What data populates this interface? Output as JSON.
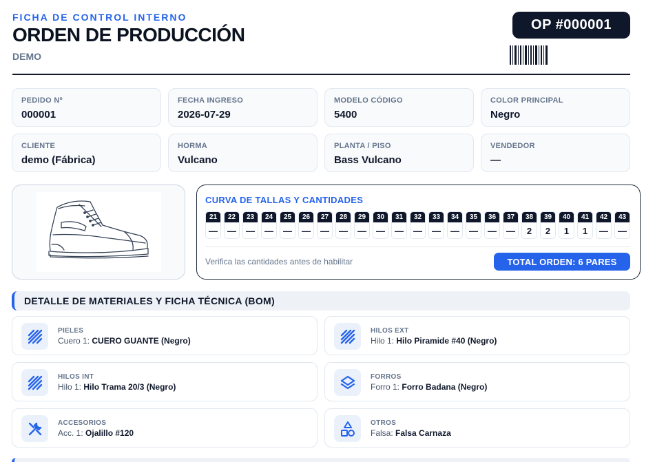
{
  "header": {
    "eyebrow": "FICHA DE CONTROL INTERNO",
    "title": "ORDEN DE PRODUCCIÓN",
    "subtitle": "DEMO",
    "op_badge": "OP #000001"
  },
  "info": [
    {
      "label": "PEDIDO Nº",
      "value": "000001"
    },
    {
      "label": "FECHA INGRESO",
      "value": "2026-07-29"
    },
    {
      "label": "MODELO CÓDIGO",
      "value": "5400"
    },
    {
      "label": "COLOR PRINCIPAL",
      "value": "Negro"
    },
    {
      "label": "CLIENTE",
      "value": "demo (Fábrica)"
    },
    {
      "label": "HORMA",
      "value": "Vulcano"
    },
    {
      "label": "PLANTA / PISO",
      "value": "Bass Vulcano"
    },
    {
      "label": "VENDEDOR",
      "value": "—"
    }
  ],
  "sizes": {
    "title": "CURVA DE TALLAS Y CANTIDADES",
    "columns": [
      {
        "size": "21",
        "qty": "—"
      },
      {
        "size": "22",
        "qty": "—"
      },
      {
        "size": "23",
        "qty": "—"
      },
      {
        "size": "24",
        "qty": "—"
      },
      {
        "size": "25",
        "qty": "—"
      },
      {
        "size": "26",
        "qty": "—"
      },
      {
        "size": "27",
        "qty": "—"
      },
      {
        "size": "28",
        "qty": "—"
      },
      {
        "size": "29",
        "qty": "—"
      },
      {
        "size": "30",
        "qty": "—"
      },
      {
        "size": "31",
        "qty": "—"
      },
      {
        "size": "32",
        "qty": "—"
      },
      {
        "size": "33",
        "qty": "—"
      },
      {
        "size": "34",
        "qty": "—"
      },
      {
        "size": "35",
        "qty": "—"
      },
      {
        "size": "36",
        "qty": "—"
      },
      {
        "size": "37",
        "qty": "—"
      },
      {
        "size": "38",
        "qty": "2"
      },
      {
        "size": "39",
        "qty": "2"
      },
      {
        "size": "40",
        "qty": "1"
      },
      {
        "size": "41",
        "qty": "1"
      },
      {
        "size": "42",
        "qty": "—"
      },
      {
        "size": "43",
        "qty": "—"
      }
    ],
    "note": "Verifica las cantidades antes de habilitar",
    "total": "TOTAL ORDEN: 6 PARES"
  },
  "materials": {
    "section_title": "DETALLE DE MATERIALES Y FICHA TÉCNICA (BOM)",
    "items": [
      {
        "category": "PIELES",
        "key": "Cuero 1:",
        "value": "CUERO GUANTE (Negro)",
        "icon": "stripes-icon"
      },
      {
        "category": "HILOS EXT",
        "key": "Hilo 1:",
        "value": "Hilo Piramide #40 (Negro)",
        "icon": "stripes-icon"
      },
      {
        "category": "HILOS INT",
        "key": "Hilo 1:",
        "value": "Hilo Trama 20/3 (Negro)",
        "icon": "stripes-icon"
      },
      {
        "category": "FORROS",
        "key": "Forro 1:",
        "value": "Forro Badana (Negro)",
        "icon": "layers-icon"
      },
      {
        "category": "ACCESORIOS",
        "key": "Acc. 1:",
        "value": "Ojalillo #120",
        "icon": "tools-icon"
      },
      {
        "category": "OTROS",
        "key": "Falsa:",
        "value": "Falsa Carnaza",
        "icon": "shapes-icon"
      }
    ]
  },
  "colors": {
    "accent": "#2563eb",
    "dark": "#0f172a",
    "muted": "#64748b"
  }
}
